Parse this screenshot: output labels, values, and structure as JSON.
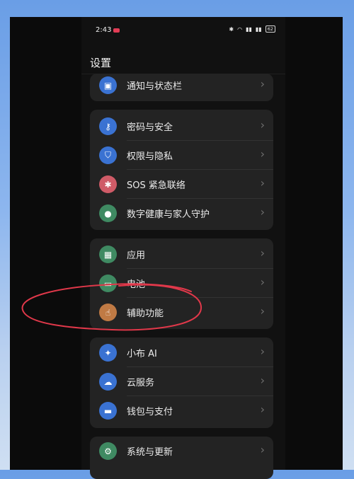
{
  "status_bar": {
    "time": "2:43",
    "icons": [
      "bluetooth-icon",
      "wifi-icon",
      "signal-icon",
      "signal-icon"
    ],
    "battery": "62"
  },
  "page_title": "设置",
  "groups": [
    {
      "items": [
        {
          "label": "通知与状态栏",
          "icon": "notification-icon",
          "color": "#3a72d2"
        }
      ]
    },
    {
      "items": [
        {
          "label": "密码与安全",
          "icon": "key-icon",
          "color": "#3a72d2"
        },
        {
          "label": "权限与隐私",
          "icon": "shield-icon",
          "color": "#3a72d2"
        },
        {
          "label": "SOS 紧急联络",
          "icon": "asterisk-icon",
          "color": "#cf5b67"
        },
        {
          "label": "数字健康与家人守护",
          "icon": "person-icon",
          "color": "#3f8a62"
        }
      ]
    },
    {
      "items": [
        {
          "label": "应用",
          "icon": "apps-grid-icon",
          "color": "#3f8a62"
        },
        {
          "label": "电池",
          "icon": "battery-icon",
          "color": "#3f8a62"
        },
        {
          "label": "辅助功能",
          "icon": "hand-icon",
          "color": "#c07a44"
        }
      ]
    },
    {
      "items": [
        {
          "label": "小布 AI",
          "icon": "ai-icon",
          "color": "#3a72d2"
        },
        {
          "label": "云服务",
          "icon": "cloud-icon",
          "color": "#3a72d2"
        },
        {
          "label": "钱包与支付",
          "icon": "wallet-icon",
          "color": "#3a72d2"
        }
      ]
    },
    {
      "items": [
        {
          "label": "系统与更新",
          "icon": "gear-icon",
          "color": "#3f8a62"
        }
      ]
    }
  ],
  "annotation_color": "#e0384a"
}
